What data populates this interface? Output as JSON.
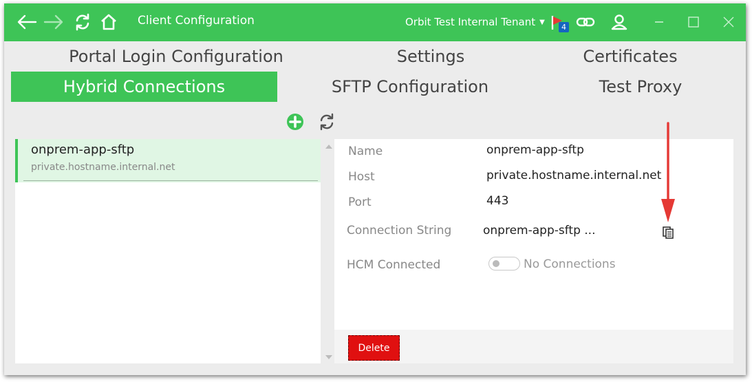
{
  "titlebar": {
    "title": "Client Configuration",
    "tenant": "Orbit Test Internal Tenant",
    "flag_count": "4",
    "icons": [
      "back-icon",
      "forward-icon",
      "refresh-icon",
      "home-icon",
      "flag-icon",
      "link-icon",
      "user-icon",
      "minimize-icon",
      "maximize-icon",
      "close-icon"
    ]
  },
  "tabs": {
    "row1": [
      "Portal Login Configuration",
      "Settings",
      "Certificates"
    ],
    "row2": [
      "Hybrid Connections",
      "SFTP Configuration",
      "Test Proxy"
    ],
    "active": "Hybrid Connections"
  },
  "toolbar": {
    "icons": [
      "add-icon",
      "refresh-icon"
    ]
  },
  "list": {
    "items": [
      {
        "name": "onprem-app-sftp",
        "host": "private.hostname.internal.net"
      }
    ]
  },
  "detail": {
    "name_label": "Name",
    "name_value": "onprem-app-sftp",
    "host_label": "Host",
    "host_value": "private.hostname.internal.net",
    "port_label": "Port",
    "port_value": "443",
    "conn_label": "Connection String",
    "conn_value": "onprem-app-sftp ...",
    "hcm_label": "HCM Connected",
    "hcm_status": "No Connections",
    "delete_label": "Delete"
  },
  "colors": {
    "accent": "#3ec457",
    "delete": "#e01010",
    "annotation_arrow": "#e53935",
    "selected_bg": "#e0f6e4"
  }
}
